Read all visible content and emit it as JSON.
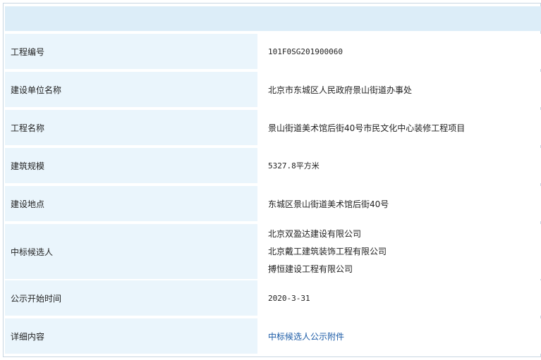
{
  "rows": [
    {
      "label": "工程编号",
      "value": "101F0SG201900060"
    },
    {
      "label": "建设单位名称",
      "value": "北京市东城区人民政府景山街道办事处"
    },
    {
      "label": "工程名称",
      "value": "景山街道美术馆后街40号市民文化中心装修工程项目"
    },
    {
      "label": "建筑规模",
      "value": "5327.8平方米"
    },
    {
      "label": "建设地点",
      "value": "东城区景山街道美术馆后街40号"
    },
    {
      "label": "中标候选人",
      "values": [
        "北京双盈达建设有限公司",
        "北京戴工建筑装饰工程有限公司",
        "搏恒建设工程有限公司"
      ]
    },
    {
      "label": "公示开始时间",
      "value": "2020-3-31"
    },
    {
      "label": "详细内容",
      "link": "中标候选人公示附件"
    }
  ]
}
